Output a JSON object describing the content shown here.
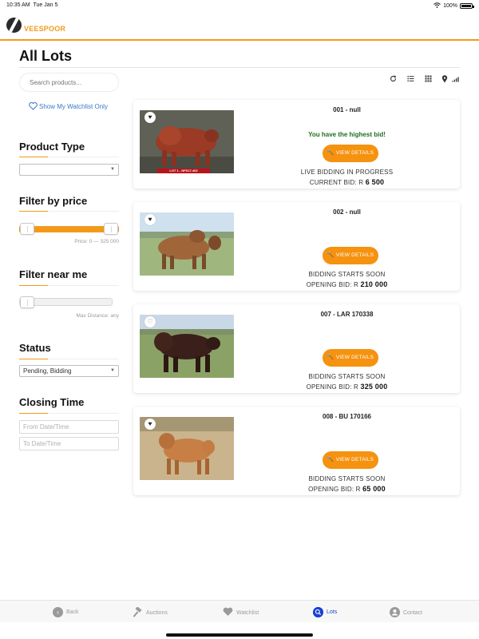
{
  "statusbar": {
    "time": "10:35 AM",
    "date": "Tue Jan 5",
    "battery": "100%"
  },
  "app": {
    "brand": "VEESPOOR",
    "accent": "#f39a1b"
  },
  "page": {
    "title": "All Lots"
  },
  "sidebar": {
    "search_placeholder": "Search products...",
    "watchlist_link": "Show My Watchlist Only",
    "product_type": {
      "title": "Product Type",
      "value": ""
    },
    "price": {
      "title": "Filter by price",
      "hint": "Price: 0 — 325 000",
      "selected_range_fraction": [
        0,
        1
      ]
    },
    "near_me": {
      "title": "Filter near me",
      "hint": "Max Distance: any",
      "level_fraction": 0
    },
    "status": {
      "title": "Status",
      "value": "Pending, Bidding"
    },
    "closing": {
      "title": "Closing Time",
      "from_placeholder": "From Date/Time",
      "to_placeholder": "To Date/Time"
    }
  },
  "toolbar": {
    "icons": [
      "refresh-icon",
      "list-view-icon",
      "grid-view-icon",
      "location-icon",
      "signal-icon"
    ]
  },
  "lots": [
    {
      "title": "001 - null",
      "highest_bid_msg": "You have the highest bid!",
      "button": "VIEW DETAILS",
      "status": "LIVE BIDDING IN PROGRESS",
      "bid_label": "CURRENT BID: R",
      "bid_value": "6 500",
      "favourited": true,
      "banner": "LOT 1 - NFS17-402"
    },
    {
      "title": "002 - null",
      "highest_bid_msg": "",
      "button": "VIEW DETAILS",
      "status": "BIDDING STARTS SOON",
      "bid_label": "OPENING BID: R",
      "bid_value": "210 000",
      "favourited": true
    },
    {
      "title": "007 - LAR 170338",
      "highest_bid_msg": "",
      "button": "VIEW DETAILS",
      "status": "BIDDING STARTS SOON",
      "bid_label": "OPENING BID: R",
      "bid_value": "325 000",
      "favourited": false
    },
    {
      "title": "008 - BU 170166",
      "highest_bid_msg": "",
      "button": "VIEW DETAILS",
      "status": "BIDDING STARTS SOON",
      "bid_label": "OPENING BID: R",
      "bid_value": "65 000",
      "favourited": true
    }
  ],
  "tabbar": {
    "items": [
      {
        "label": "Back",
        "icon": "back-icon"
      },
      {
        "label": "Auctions",
        "icon": "gavel-icon"
      },
      {
        "label": "Watchlist",
        "icon": "heart-icon"
      },
      {
        "label": "Lots",
        "icon": "search-icon",
        "active": true
      },
      {
        "label": "Contact",
        "icon": "person-icon"
      }
    ]
  }
}
